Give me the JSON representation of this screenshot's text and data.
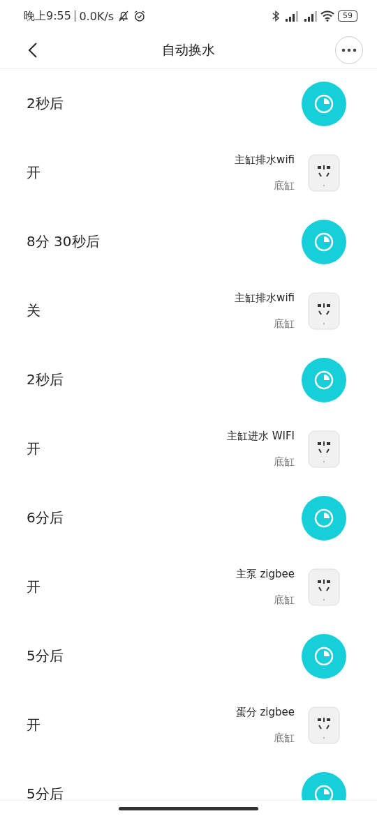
{
  "status_bar": {
    "time": "晚上9:55",
    "speed": "0.0K/s",
    "battery": "59"
  },
  "header": {
    "title": "自动换水"
  },
  "steps": [
    {
      "kind": "delay",
      "label": "2秒后"
    },
    {
      "kind": "device",
      "label": "开",
      "device": "主缸排水wifi",
      "room": "底缸"
    },
    {
      "kind": "delay",
      "label": "8分 30秒后"
    },
    {
      "kind": "device",
      "label": "关",
      "device": "主缸排水wifi",
      "room": "底缸"
    },
    {
      "kind": "delay",
      "label": "2秒后"
    },
    {
      "kind": "device",
      "label": "开",
      "device": "主缸进水 WIFI",
      "room": "底缸"
    },
    {
      "kind": "delay",
      "label": "6分后"
    },
    {
      "kind": "device",
      "label": "开",
      "device": "主泵 zigbee",
      "room": "底缸"
    },
    {
      "kind": "delay",
      "label": "5分后"
    },
    {
      "kind": "device",
      "label": "开",
      "device": "蛋分 zigbee",
      "room": "底缸"
    },
    {
      "kind": "delay",
      "label": "5分后"
    }
  ]
}
